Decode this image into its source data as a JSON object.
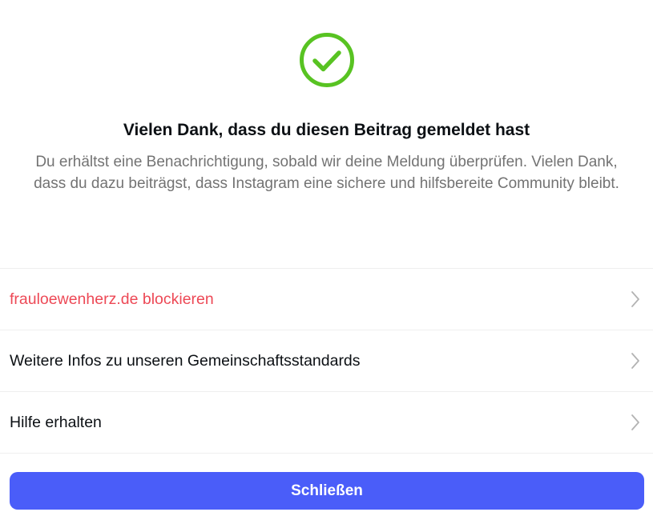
{
  "header": {
    "icon": "check-circle-icon",
    "icon_color": "#58c322",
    "title": "Vielen Dank, dass du diesen Beitrag gemeldet hast",
    "description": "Du erhältst eine Benachrichtigung, sobald wir deine Meldung überprüfen. Vielen Dank, dass du dazu beiträgst, dass Instagram eine sichere und hilfsbereite Community bleibt."
  },
  "options": [
    {
      "label": "frauloewenherz.de blockieren",
      "color": "#ed4956",
      "icon": "chevron-right-icon"
    },
    {
      "label": "Weitere Infos zu unseren Gemeinschaftsstandards",
      "color": "#0c1014",
      "icon": "chevron-right-icon"
    },
    {
      "label": "Hilfe erhalten",
      "color": "#0c1014",
      "icon": "chevron-right-icon"
    }
  ],
  "footer": {
    "close_label": "Schließen",
    "button_color": "#4a5df9"
  }
}
